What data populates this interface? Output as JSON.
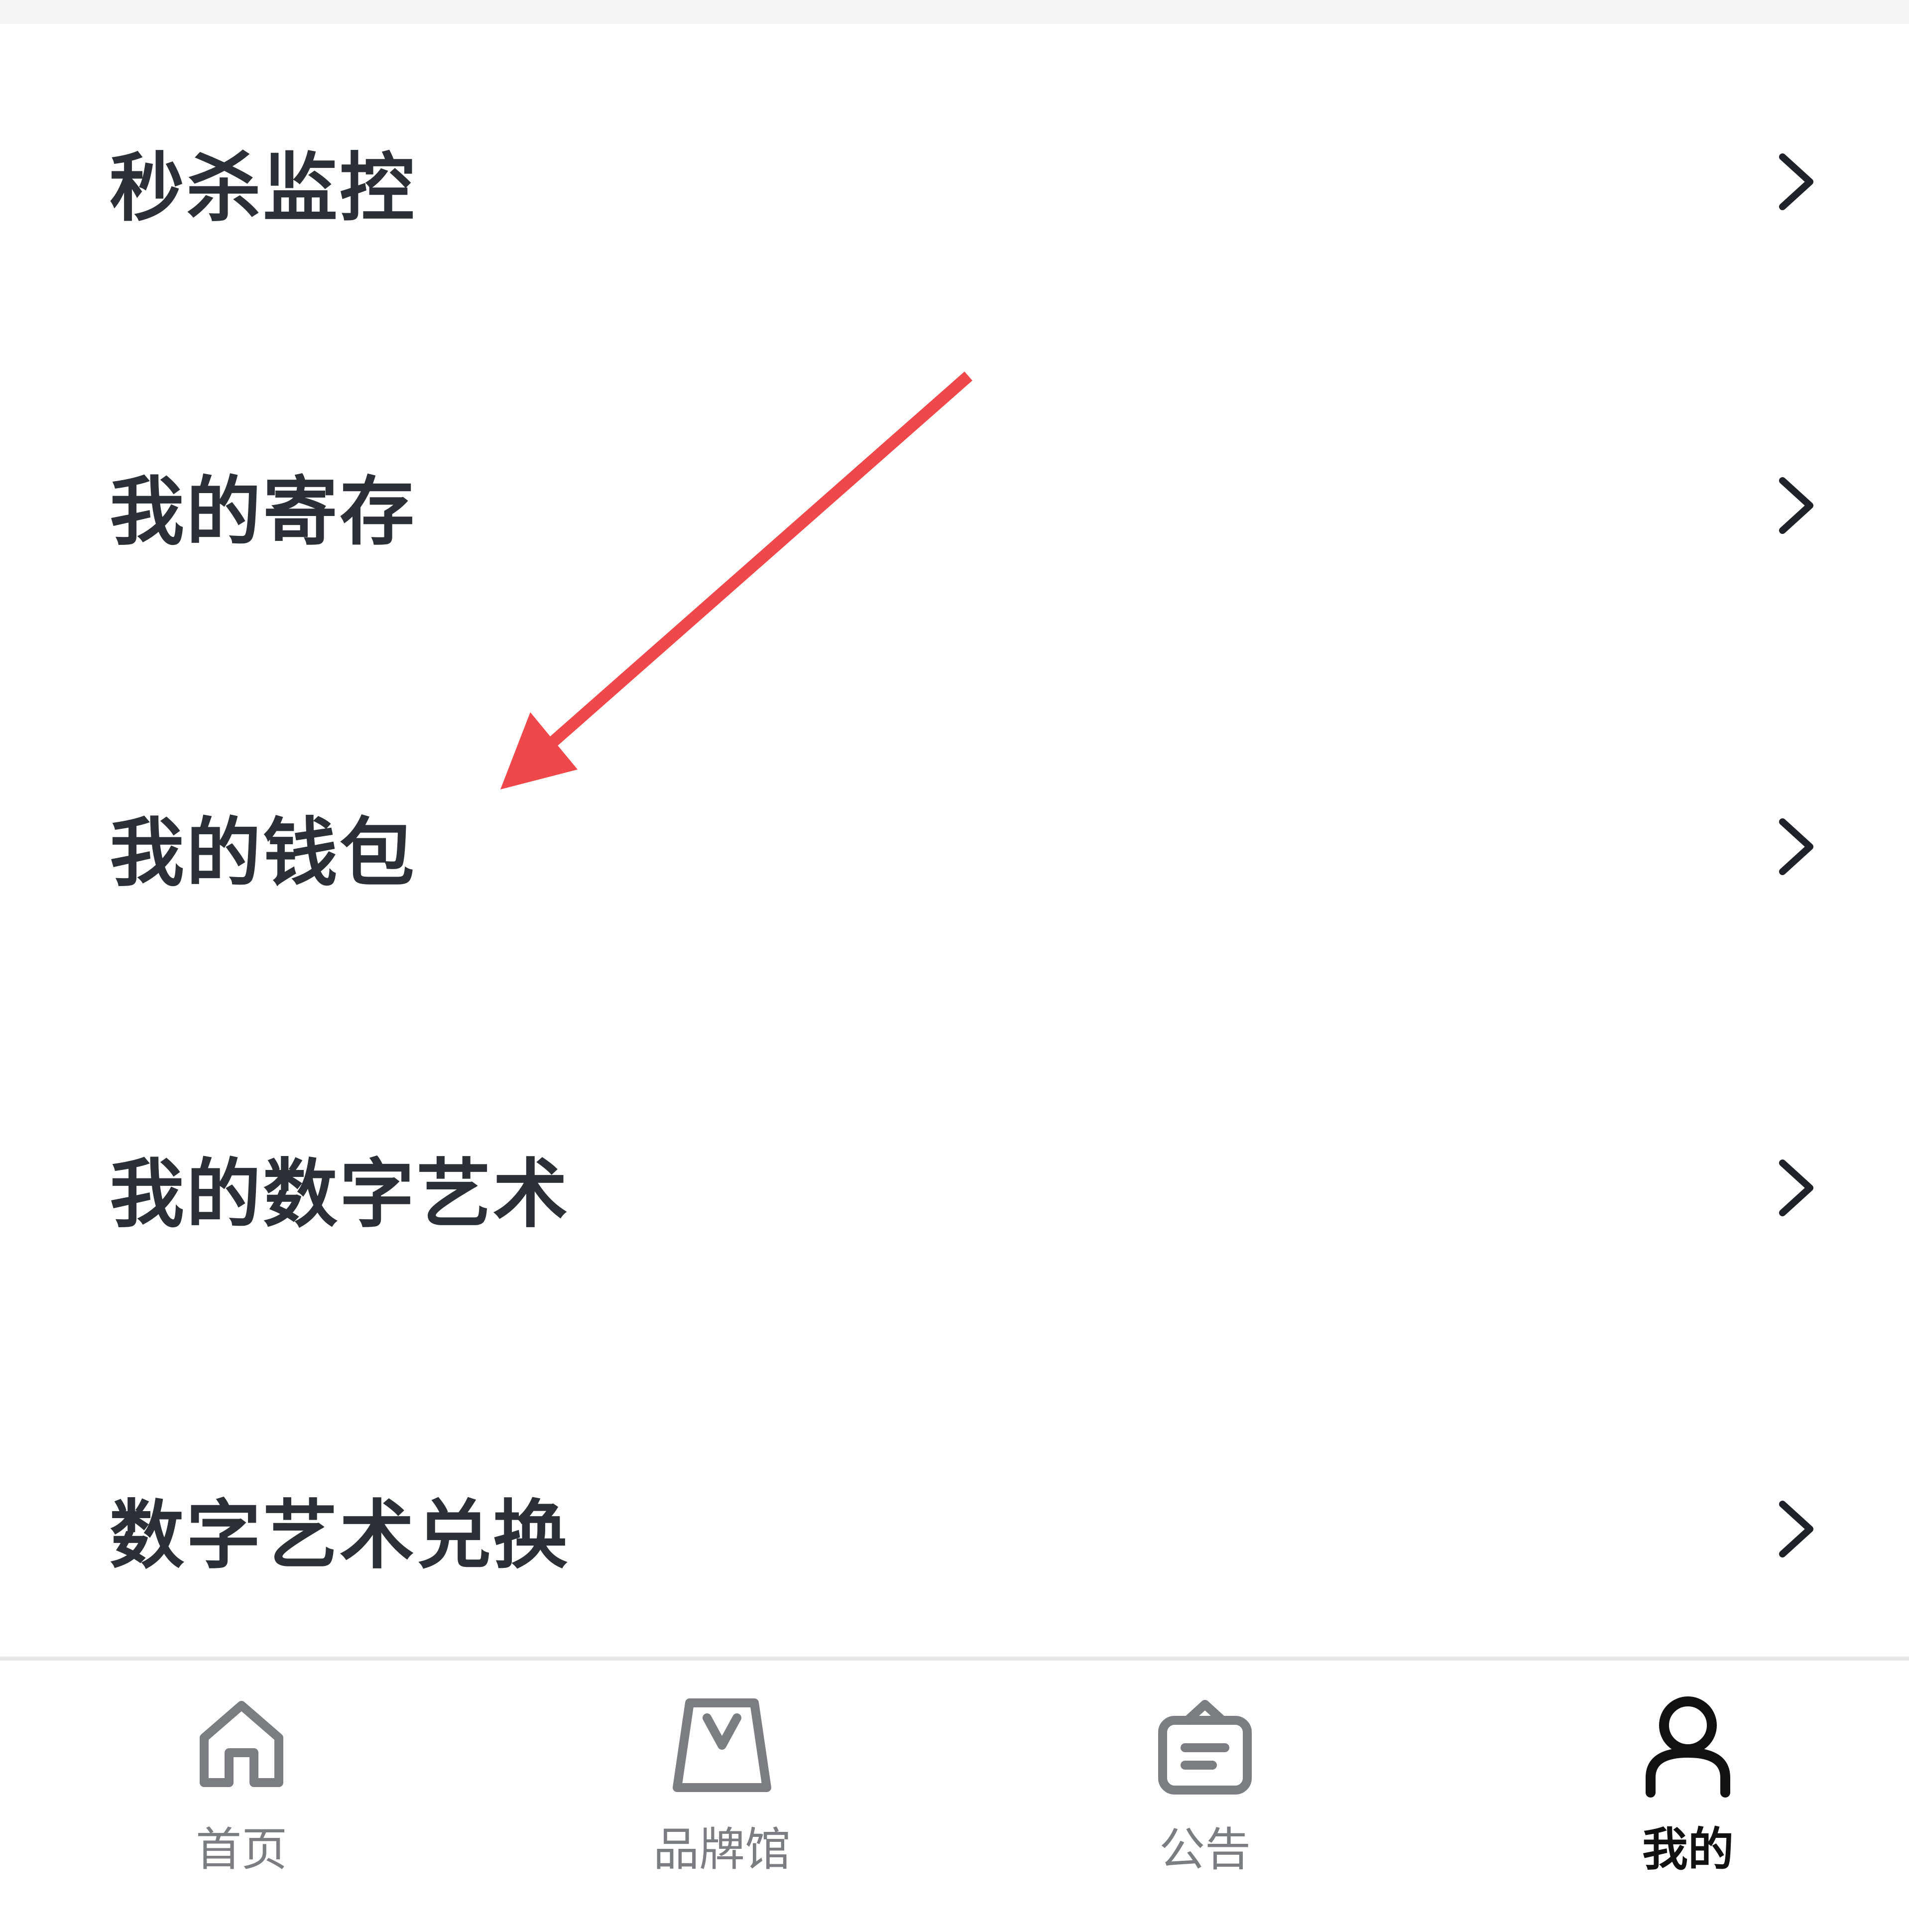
{
  "menu": {
    "items": [
      {
        "label": "秒杀监控"
      },
      {
        "label": "我的寄存"
      },
      {
        "label": "我的钱包"
      },
      {
        "label": "我的数字艺术"
      },
      {
        "label": "数字艺术兑换"
      }
    ]
  },
  "tabbar": {
    "tabs": [
      {
        "label": "首页",
        "icon": "home-icon"
      },
      {
        "label": "品牌馆",
        "icon": "brand-bag-icon"
      },
      {
        "label": "公告",
        "icon": "announcement-icon"
      },
      {
        "label": "我的",
        "icon": "user-icon",
        "active": true
      }
    ]
  },
  "colors": {
    "text": "#2b2f36",
    "tab_inactive": "#7a7d82",
    "tab_active": "#111111",
    "annotation_arrow": "#f0474a",
    "top_strip": "#f3f4f6"
  }
}
